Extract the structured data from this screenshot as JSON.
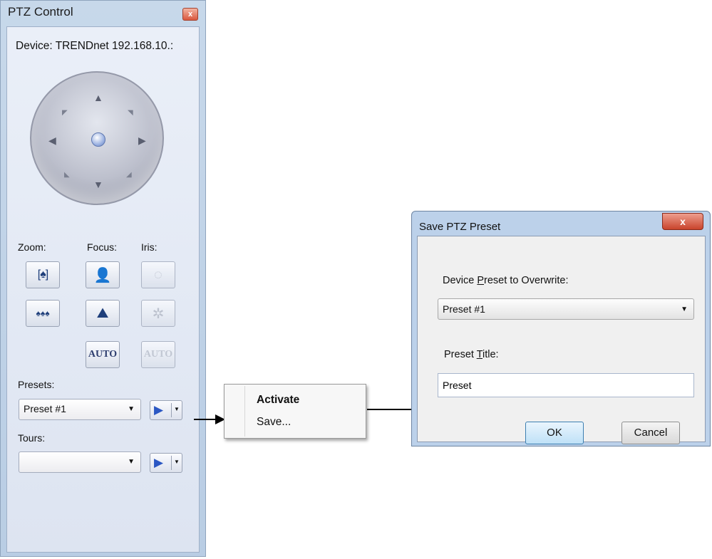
{
  "ptz": {
    "title": "PTZ Control",
    "close_glyph": "x",
    "device_label": "Device: TRENDnet 192.168.10.:",
    "zoom_label": "Zoom:",
    "focus_label": "Focus:",
    "iris_label": "Iris:",
    "focus_auto_label": "AUTO",
    "iris_auto_label": "AUTO",
    "presets_label": "Presets:",
    "preset_selected": "Preset #1",
    "tours_label": "Tours:",
    "tour_selected": ""
  },
  "context_menu": {
    "activate_label": "Activate",
    "save_label": "Save..."
  },
  "dialog": {
    "title": "Save PTZ Preset",
    "close_glyph": "x",
    "overwrite_label_pre": "Device ",
    "overwrite_label_accel": "P",
    "overwrite_label_post": "reset to Overwrite:",
    "preset_selected": "Preset #1",
    "title_label_pre": "Preset ",
    "title_label_accel": "T",
    "title_label_post": "itle:",
    "title_value": "Preset",
    "ok_label": "OK",
    "cancel_label": "Cancel"
  },
  "icons": {
    "joystick": "ptz-joystick",
    "zoom_in": "zoom-in-icon",
    "zoom_out": "zoom-out-icon",
    "focus_near": "focus-near-icon",
    "focus_far": "focus-far-icon",
    "iris_open": "iris-open-icon",
    "iris_close": "iris-close-icon",
    "play": "play-icon",
    "dropdown": "chevron-down-icon"
  }
}
